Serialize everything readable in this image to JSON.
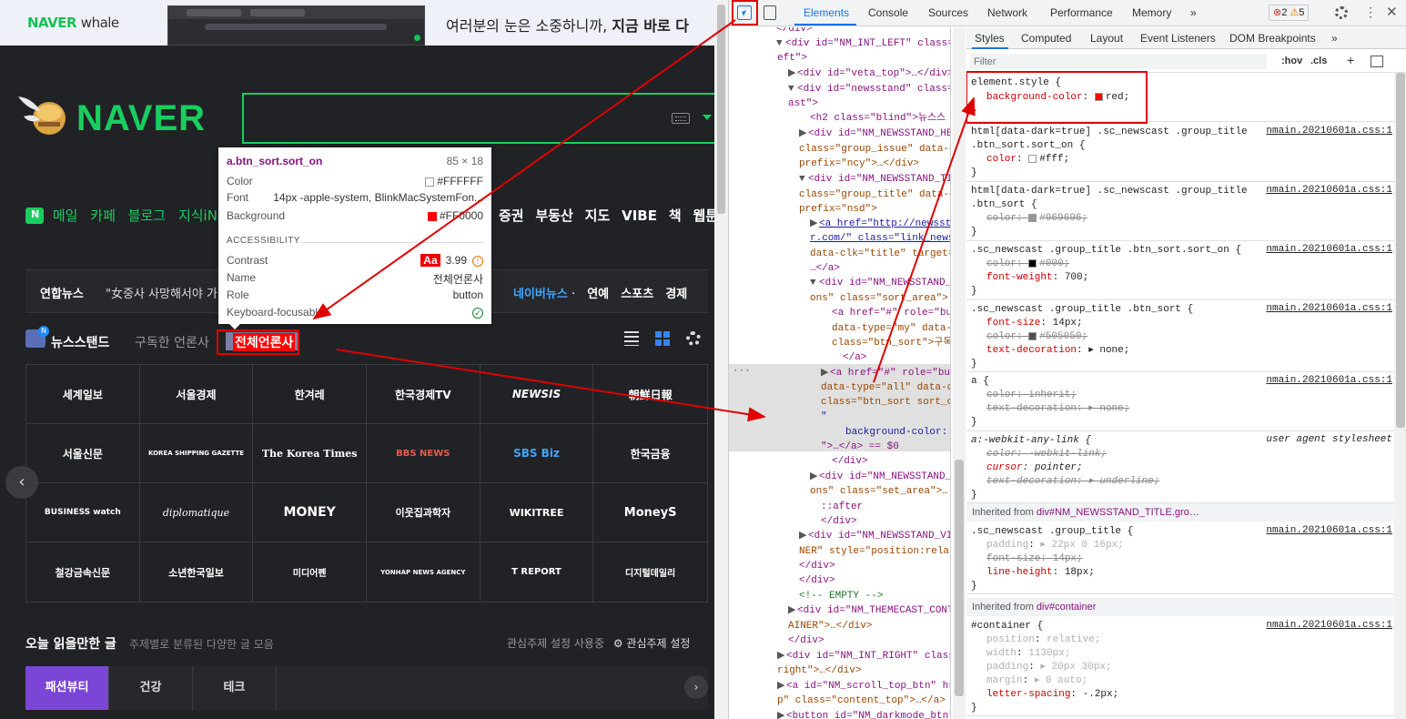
{
  "whale": {
    "logo_brand": "NAVER",
    "logo_product": "whale",
    "promo_text": "여러분의 눈은 소중하니까, ",
    "promo_bold": "지금 바로 다"
  },
  "naver": {
    "logo": "NAVER",
    "nav_green": [
      "메일",
      "카페",
      "블로그",
      "지식iN"
    ],
    "nav_white": [
      "증권",
      "부동산",
      "지도",
      "VIBE",
      "책",
      "웹툰"
    ],
    "ticker_press": "연합뉴스",
    "ticker_headline": "\"女중사 사망해서야 가",
    "ticker_navernews": "네이버뉴스",
    "ticker_links": [
      "연예",
      "스포츠",
      "경제"
    ],
    "newsstand_title": "뉴스스탠드",
    "newsstand_subscribed": "구독한 언론사",
    "newsstand_all": "전체언론사",
    "press_grid": [
      [
        "세계일보",
        "서울경제",
        "한겨레",
        "한국경제TV",
        "NEWSIS",
        "朝鮮日報"
      ],
      [
        "서울신문",
        "KOREA SHIPPING GAZETTE",
        "The Korea Times",
        "BBS NEWS",
        "SBS Biz",
        "한국금융"
      ],
      [
        "BUSINESS watch",
        "diplomatique",
        "MONEY",
        "이웃집과학자",
        "WIKITREE",
        "MoneyS"
      ],
      [
        "철강금속신문",
        "소년한국일보",
        "미디어펜",
        "YONHAP NEWS AGENCY",
        "T REPORT",
        "디지털데일리"
      ]
    ],
    "prev_icon": "‹",
    "reco_title": "오늘 읽을만한 글",
    "reco_sub": "주제별로 분류된 다양한 글 모음",
    "reco_right": "관심주제 설정 사용중",
    "reco_setting": "⚙ 관심주제 설정",
    "reco_tabs": [
      "패션뷰티",
      "건강",
      "테크"
    ],
    "next_icon": "›"
  },
  "tooltip": {
    "selector": "a.btn_sort.sort_on",
    "size": "85 × 18",
    "rows": [
      {
        "label": "Color",
        "value": "#FFFFFF"
      },
      {
        "label": "Font",
        "value": "14px -apple-system, BlinkMacSystemFon..."
      },
      {
        "label": "Background",
        "value": "#FF0000"
      }
    ],
    "accessibility_header": "ACCESSIBILITY",
    "contrast_label": "Contrast",
    "contrast_aa": "Aa",
    "contrast_value": "3.99",
    "name_label": "Name",
    "name_value": "전체언론사",
    "role_label": "Role",
    "role_value": "button",
    "kb_label": "Keyboard-focusable"
  },
  "devtools": {
    "tabs": [
      "Elements",
      "Console",
      "Sources",
      "Network",
      "Performance",
      "Memory"
    ],
    "more_tabs": "»",
    "errors": "2",
    "warnings": "5",
    "close": "✕",
    "more": "⋮",
    "style_tabs": [
      "Styles",
      "Computed",
      "Layout",
      "Event Listeners",
      "DOM Breakpoints"
    ],
    "style_more": "»",
    "filter_placeholder": "Filter",
    "hov": ":hov",
    "cls": ".cls",
    "plus": "+",
    "elements": [
      "</div>",
      "<div id=\"NM_INT_LEFT\" class=",
      "eft\">",
      "<div id=\"veta_top\">…</div>",
      "<div id=\"newsstand\" class=",
      "ast\">",
      "<h2 class=\"blind\">뉴스스",
      "<div id=\"NM_NEWSSTAND_HE",
      "class=\"group_issue\" data-c",
      "prefix=\"ncy\">…</div>",
      "<div id=\"NM_NEWSSTAND_TI",
      "class=\"group_title\" data-c",
      "prefix=\"nsd\">",
      "<a href=\"http://newsst",
      "r.com/\" class=\"link_news",
      "data-clk=\"title\" target=",
      "…</a>",
      "<div id=\"NM_NEWSSTAND_",
      "ons\" class=\"sort_area\">",
      "<a href=\"#\" role=\"bu",
      "data-type=\"my\" data-",
      "class=\"btn_sort\">구독",
      "</a>",
      "<a href=\"#\" role=\"bu",
      "data-type=\"all\" data-c",
      "class=\"btn_sort sort_o",
      "\"",
      "background-color:",
      "\">…</a> == $0",
      "</div>",
      "<div id=\"NM_NEWSSTAND_",
      "ons\" class=\"set_area\">…",
      "::after",
      "</div>",
      "<div id=\"NM_NEWSSTAND_VI",
      "NER\" style=\"position:rela",
      "</div>",
      "</div>",
      "<!-- EMPTY -->",
      "<div id=\"NM_THEMECAST_CONT",
      "AINER\">…</div>",
      "</div>",
      "<div id=\"NM_INT_RIGHT\" class",
      "right\">…</div>",
      "<a id=\"NM_scroll_top_btn\" hr",
      "p\" class=\"content_top\">…</a>",
      "<button id=\"NM_darkmode_btn\""
    ],
    "rules": [
      {
        "selector": "element.style {",
        "source": "",
        "props": [
          {
            "name": "background-color",
            "value": "red;",
            "swatch": "#ff0000",
            "state": "normal"
          }
        ]
      },
      {
        "selector": "html[data-dark=true] .sc_newscast .group_title",
        "selector2": ".btn_sort.sort_on {",
        "source": "nmain.20210601a.css:1",
        "props": [
          {
            "name": "color",
            "value": "#fff;",
            "swatch": "#ffffff",
            "state": "normal"
          }
        ]
      },
      {
        "selector": "html[data-dark=true] .sc_newscast .group_title",
        "selector2": ".btn_sort {",
        "source": "nmain.20210601a.css:1",
        "props": [
          {
            "name": "color",
            "value": "#969696;",
            "swatch": "#969696",
            "state": "strike"
          }
        ]
      },
      {
        "selector": ".sc_newscast .group_title .btn_sort.sort_on {",
        "source": "nmain.20210601a.css:1",
        "props": [
          {
            "name": "color",
            "value": "#000;",
            "swatch": "#000000",
            "state": "strike"
          },
          {
            "name": "font-weight",
            "value": "700;",
            "state": "normal"
          }
        ]
      },
      {
        "selector": ".sc_newscast .group_title .btn_sort {",
        "source": "nmain.20210601a.css:1",
        "props": [
          {
            "name": "font-size",
            "value": "14px;",
            "state": "normal"
          },
          {
            "name": "color",
            "value": "#505050;",
            "swatch": "#505050",
            "state": "strike"
          },
          {
            "name": "text-decoration",
            "value": "▸ none;",
            "state": "normal"
          }
        ]
      },
      {
        "selector": "a {",
        "source": "nmain.20210601a.css:1",
        "props": [
          {
            "name": "color",
            "value": "inherit;",
            "state": "strike"
          },
          {
            "name": "text-decoration",
            "value": "▸ none;",
            "state": "strike"
          }
        ]
      },
      {
        "selector": "a:-webkit-any-link {",
        "source": "user agent stylesheet",
        "props": [
          {
            "name": "color",
            "value": "-webkit-link;",
            "state": "strike"
          },
          {
            "name": "cursor",
            "value": "pointer;",
            "state": "normal"
          },
          {
            "name": "text-decoration",
            "value": "▸ underline;",
            "state": "strike"
          }
        ]
      }
    ],
    "inherited1": {
      "label": "Inherited from ",
      "tag": "div#NM_NEWSSTAND_TITLE.gro…"
    },
    "rule_group_title": {
      "selector": ".sc_newscast .group_title {",
      "source": "nmain.20210601a.css:1",
      "props": [
        {
          "name": "padding",
          "value": "▸ 22px 0 16px;",
          "state": "dim"
        },
        {
          "name": "font-size",
          "value": "14px;",
          "state": "strike"
        },
        {
          "name": "line-height",
          "value": "18px;",
          "state": "normal"
        }
      ]
    },
    "inherited2": {
      "label": "Inherited from ",
      "tag": "div#container"
    },
    "rule_container": {
      "selector": "#container {",
      "source": "nmain.20210601a.css:1",
      "props": [
        {
          "name": "position",
          "value": "relative;",
          "state": "dim"
        },
        {
          "name": "width",
          "value": "1130px;",
          "state": "dim"
        },
        {
          "name": "padding",
          "value": "▸ 20px 30px;",
          "state": "dim"
        },
        {
          "name": "margin",
          "value": "▸ 0 auto;",
          "state": "dim"
        },
        {
          "name": "letter-spacing",
          "value": "-.2px;",
          "state": "normal"
        }
      ]
    }
  }
}
